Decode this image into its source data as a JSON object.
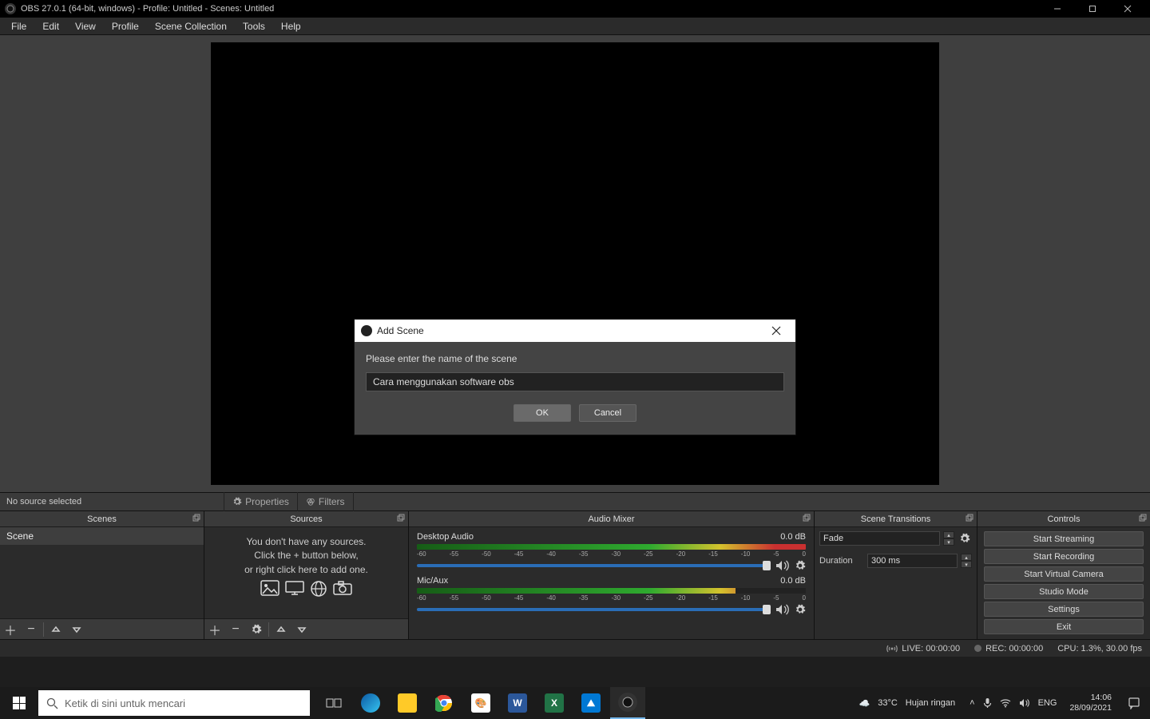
{
  "titlebar": {
    "title": "OBS 27.0.1 (64-bit, windows) - Profile: Untitled - Scenes: Untitled"
  },
  "menubar": {
    "items": [
      "File",
      "Edit",
      "View",
      "Profile",
      "Scene Collection",
      "Tools",
      "Help"
    ]
  },
  "src_toolbar": {
    "no_source": "No source selected",
    "properties": "Properties",
    "filters": "Filters"
  },
  "docks": {
    "scenes": {
      "title": "Scenes",
      "items": [
        "Scene"
      ]
    },
    "sources": {
      "title": "Sources",
      "empty1": "You don't have any sources.",
      "empty2": "Click the + button below,",
      "empty3": "or right click here to add one."
    },
    "mixer": {
      "title": "Audio Mixer",
      "tracks": [
        {
          "name": "Desktop Audio",
          "db": "0.0 dB"
        },
        {
          "name": "Mic/Aux",
          "db": "0.0 dB"
        }
      ],
      "ticks": [
        "-60",
        "-55",
        "-50",
        "-45",
        "-40",
        "-35",
        "-30",
        "-25",
        "-20",
        "-15",
        "-10",
        "-5",
        "0"
      ]
    },
    "transitions": {
      "title": "Scene Transitions",
      "selected": "Fade",
      "duration_label": "Duration",
      "duration_value": "300 ms"
    },
    "controls": {
      "title": "Controls",
      "buttons": [
        "Start Streaming",
        "Start Recording",
        "Start Virtual Camera",
        "Studio Mode",
        "Settings",
        "Exit"
      ]
    }
  },
  "statusbar": {
    "live": "LIVE: 00:00:00",
    "rec": "REC: 00:00:00",
    "cpu": "CPU: 1.3%, 30.00 fps"
  },
  "dialog": {
    "title": "Add Scene",
    "message": "Please enter the name of the scene",
    "value": "Cara menggunakan software obs",
    "ok": "OK",
    "cancel": "Cancel"
  },
  "taskbar": {
    "search_placeholder": "Ketik di sini untuk mencari",
    "weather_temp": "33°C",
    "weather_desc": "Hujan ringan",
    "lang": "ENG",
    "time": "14:06",
    "date": "28/09/2021"
  }
}
